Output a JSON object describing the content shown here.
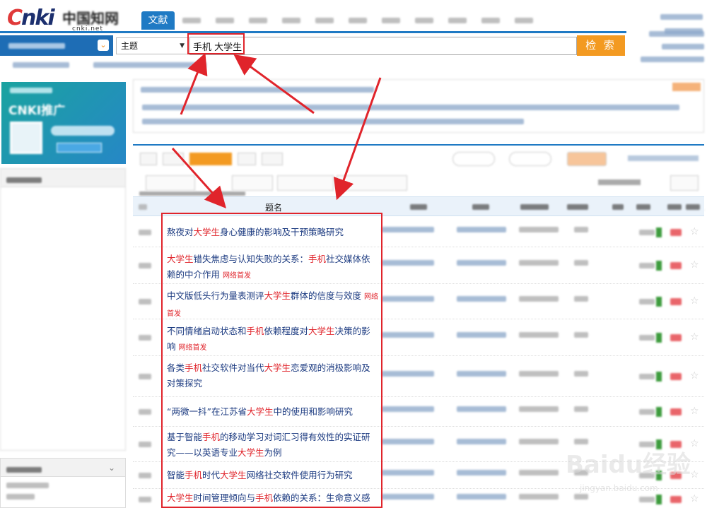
{
  "header": {
    "logo_text_cnki": "CNKI",
    "logo_text_zh": "中国知网",
    "logo_url": "cnki.net",
    "active_tab": "文献"
  },
  "search": {
    "field": "主题",
    "query": "手机 大学生",
    "button": "检 索"
  },
  "table": {
    "title_header": "题名",
    "rows": [
      {
        "segments": [
          [
            "熬夜对",
            false
          ],
          [
            "大学生",
            true
          ],
          [
            "身心健康的影响及干预策略研究",
            false
          ]
        ],
        "badge": ""
      },
      {
        "segments": [
          [
            "大学生",
            true
          ],
          [
            "错失焦虑与认知失败的关系：",
            false
          ],
          [
            "手机",
            true
          ],
          [
            "社交媒体依赖的中介作用",
            false
          ]
        ],
        "badge": "网络首发"
      },
      {
        "segments": [
          [
            "中文版低头行为量表测评",
            false
          ],
          [
            "大学生",
            true
          ],
          [
            "群体的信度与效度",
            false
          ]
        ],
        "badge": "网络首发"
      },
      {
        "segments": [
          [
            "不同情绪启动状态和",
            false
          ],
          [
            "手机",
            true
          ],
          [
            "依赖程度对",
            false
          ],
          [
            "大学生",
            true
          ],
          [
            "决策的影响",
            false
          ]
        ],
        "badge": "网络首发"
      },
      {
        "segments": [
          [
            "各类",
            false
          ],
          [
            "手机",
            true
          ],
          [
            "社交软件对当代",
            false
          ],
          [
            "大学生",
            true
          ],
          [
            "恋爱观的消极影响及对策探究",
            false
          ]
        ],
        "badge": ""
      },
      {
        "segments": [
          [
            "“两微一抖”在江苏省",
            false
          ],
          [
            "大学生",
            true
          ],
          [
            "中的使用和影响研究",
            false
          ]
        ],
        "badge": ""
      },
      {
        "segments": [
          [
            "基于智能",
            false
          ],
          [
            "手机",
            true
          ],
          [
            "的移动学习对词汇习得有效性的实证研究——以英语专业",
            false
          ],
          [
            "大学生",
            true
          ],
          [
            "为例",
            false
          ]
        ],
        "badge": ""
      },
      {
        "segments": [
          [
            "智能",
            false
          ],
          [
            "手机",
            true
          ],
          [
            "时代",
            false
          ],
          [
            "大学生",
            true
          ],
          [
            "网络社交软件使用行为研究",
            false
          ]
        ],
        "badge": ""
      },
      {
        "segments": [
          [
            "大学生",
            true
          ],
          [
            "时间管理倾向与",
            false
          ],
          [
            "手机",
            true
          ],
          [
            "依赖的关系：生命意义感",
            false
          ]
        ],
        "badge": ""
      }
    ]
  },
  "watermark": {
    "brand": "Baidu经验",
    "url": "jingyan.baidu.com"
  },
  "colors": {
    "accent_blue": "#1f7ac4",
    "accent_orange": "#f39a21",
    "annotation_red": "#e0242b",
    "keyword_red": "#e0242b",
    "title_blue": "#1b3a80"
  },
  "icons": [
    "dropdown-arrow-icon",
    "chevron-down-icon",
    "download-icon",
    "read-icon",
    "star-icon"
  ]
}
